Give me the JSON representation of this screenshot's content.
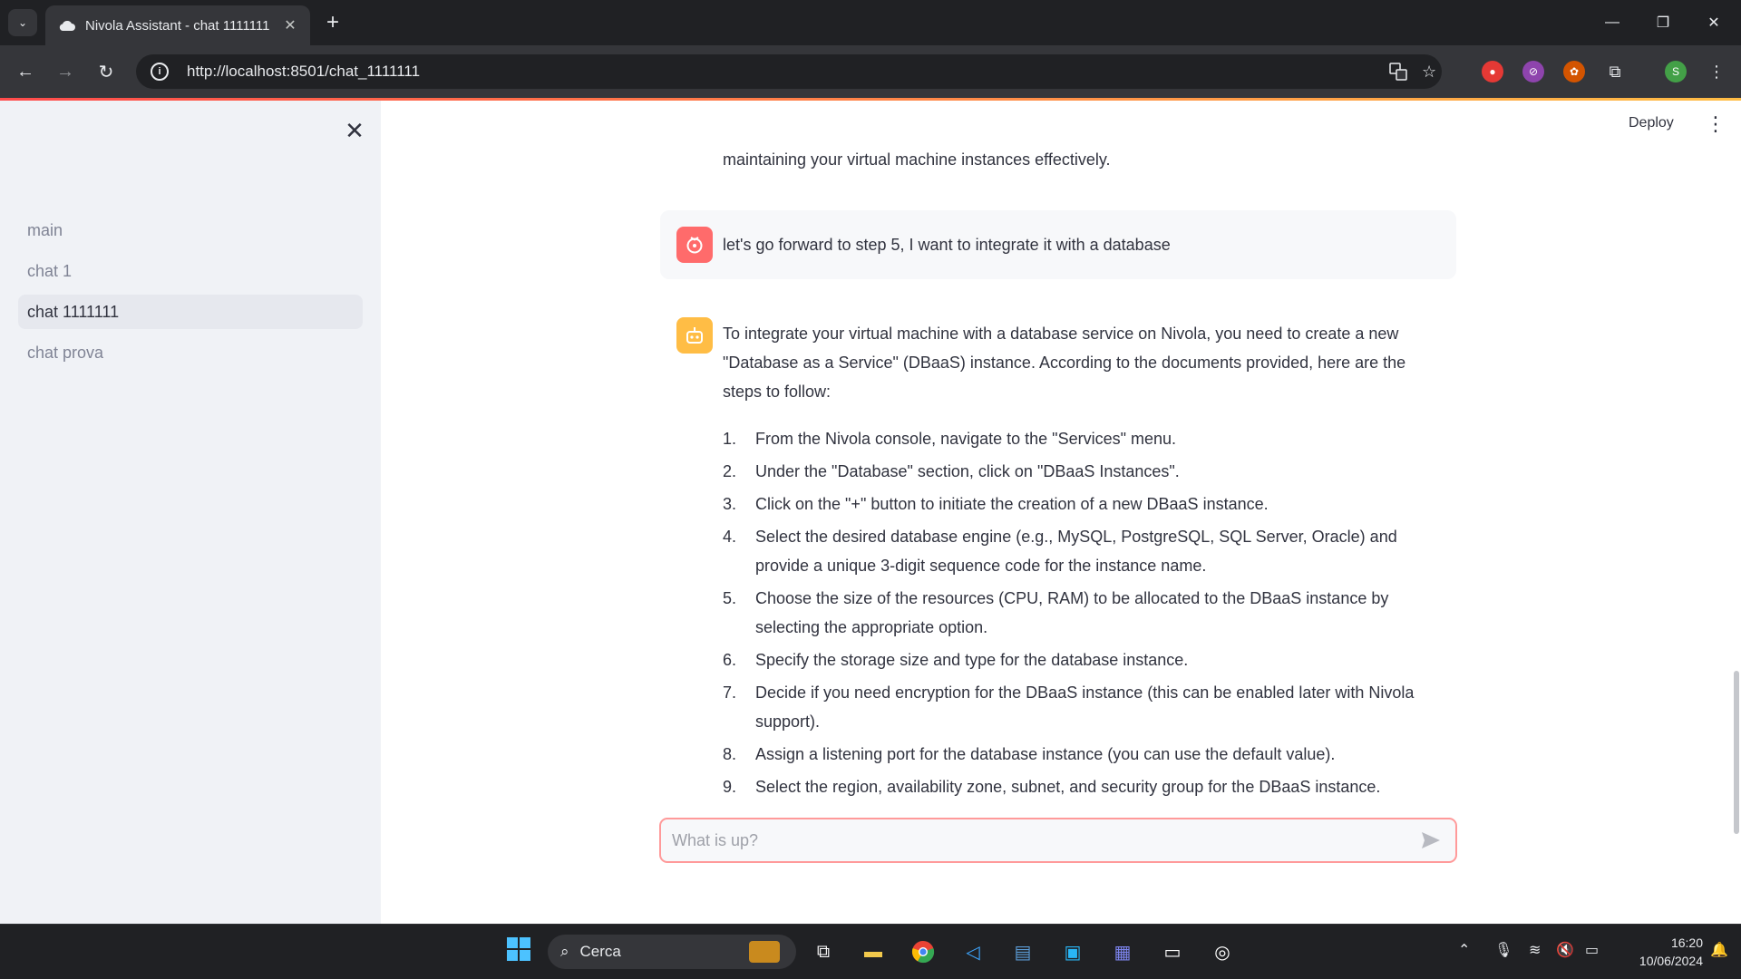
{
  "browser": {
    "tab_title": "Nivola Assistant - chat 1111111",
    "url": "http://localhost:8501/chat_1111111"
  },
  "sidebar": {
    "items": [
      {
        "label": "main"
      },
      {
        "label": "chat 1"
      },
      {
        "label": "chat 1111111"
      },
      {
        "label": "chat prova"
      }
    ],
    "active_item": "chat 1111111"
  },
  "header": {
    "deploy_label": "Deploy"
  },
  "conversation": {
    "previous_tail": "maintaining your virtual machine instances effectively.",
    "user_message": "let's go forward to step 5, I want to integrate it with a database",
    "assistant_intro": "To integrate your virtual machine with a database service on Nivola, you need to create a new \"Database as a Service\" (DBaaS) instance. According to the documents provided, here are the steps to follow:",
    "steps": [
      {
        "num": "1.",
        "text": "From the Nivola console, navigate to the \"Services\" menu."
      },
      {
        "num": "2.",
        "text": "Under the \"Database\" section, click on \"DBaaS Instances\"."
      },
      {
        "num": "3.",
        "text": "Click on the \"+\" button to initiate the creation of a new DBaaS instance."
      },
      {
        "num": "4.",
        "text": "Select the desired database engine (e.g., MySQL, PostgreSQL, SQL Server, Oracle) and provide a unique 3-digit sequence code for the instance name."
      },
      {
        "num": "5.",
        "text": "Choose the size of the resources (CPU, RAM) to be allocated to the DBaaS instance by selecting the appropriate option."
      },
      {
        "num": "6.",
        "text": "Specify the storage size and type for the database instance."
      },
      {
        "num": "7.",
        "text": "Decide if you need encryption for the DBaaS instance (this can be enabled later with Nivola support)."
      },
      {
        "num": "8.",
        "text": "Assign a listening port for the database instance (you can use the default value)."
      },
      {
        "num": "9.",
        "text": "Select the region, availability zone, subnet, and security group for the DBaaS instance."
      }
    ]
  },
  "chat_input": {
    "placeholder": "What is up?",
    "value": ""
  },
  "taskbar": {
    "search_label": "Cerca",
    "time": "16:20",
    "date": "10/06/2024"
  },
  "colors": {
    "accent": "#ff4b4b",
    "sidebar_bg": "#f0f2f6",
    "user_avatar": "#ff6b6b",
    "bot_avatar": "#ffbd45"
  }
}
